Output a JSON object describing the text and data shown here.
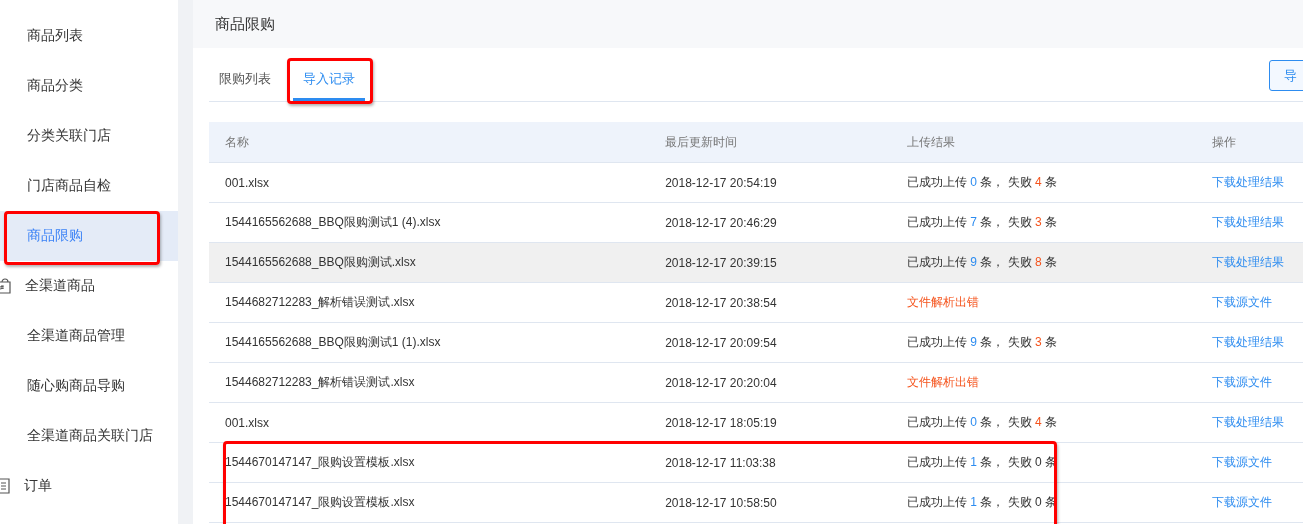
{
  "sidebar": {
    "items": [
      {
        "label": "商品列表",
        "kind": "link",
        "selected": false,
        "circled": false
      },
      {
        "label": "商品分类",
        "kind": "link",
        "selected": false,
        "circled": false
      },
      {
        "label": "分类关联门店",
        "kind": "link",
        "selected": false,
        "circled": false
      },
      {
        "label": "门店商品自检",
        "kind": "link",
        "selected": false,
        "circled": false
      },
      {
        "label": "商品限购",
        "kind": "link",
        "selected": true,
        "circled": true
      },
      {
        "label": "全渠道商品",
        "kind": "group",
        "selected": false,
        "circled": false
      },
      {
        "label": "全渠道商品管理",
        "kind": "link",
        "selected": false,
        "circled": false
      },
      {
        "label": "随心购商品导购",
        "kind": "link",
        "selected": false,
        "circled": false
      },
      {
        "label": "全渠道商品关联门店",
        "kind": "link",
        "selected": false,
        "circled": false
      },
      {
        "label": "订单",
        "kind": "group",
        "selected": false,
        "circled": false
      }
    ]
  },
  "page": {
    "title": "商品限购",
    "tabs": [
      {
        "label": "限购列表",
        "selected": false,
        "circled": false
      },
      {
        "label": "导入记录",
        "selected": true,
        "circled": true
      }
    ],
    "button": "导",
    "table": {
      "columns": [
        "名称",
        "最后更新时间",
        "上传结果",
        "操作"
      ],
      "rows": [
        {
          "name": "001.xlsx",
          "time": "2018-12-17 20:54:19",
          "result": {
            "kind": "counts",
            "a": "已成功上传",
            "ok": "0",
            "b": "条，",
            "c": "失败",
            "fail": "4",
            "fail_highlight": true,
            "d": "条"
          },
          "action": "下载处理结果",
          "hovered": false,
          "circled": false
        },
        {
          "name": "1544165562688_BBQ限购测试1 (4).xlsx",
          "time": "2018-12-17 20:46:29",
          "result": {
            "kind": "counts",
            "a": "已成功上传",
            "ok": "7",
            "b": "条，",
            "c": "失败",
            "fail": "3",
            "fail_highlight": true,
            "d": "条"
          },
          "action": "下载处理结果",
          "hovered": false,
          "circled": false
        },
        {
          "name": "1544165562688_BBQ限购测试.xlsx",
          "time": "2018-12-17 20:39:15",
          "result": {
            "kind": "counts",
            "a": "已成功上传",
            "ok": "9",
            "b": "条，",
            "c": "失败",
            "fail": "8",
            "fail_highlight": true,
            "d": "条"
          },
          "action": "下载处理结果",
          "hovered": true,
          "circled": false
        },
        {
          "name": "1544682712283_解析错误测试.xlsx",
          "time": "2018-12-17 20:38:54",
          "result": {
            "kind": "error",
            "text": "文件解析出错"
          },
          "action": "下载源文件",
          "hovered": false,
          "circled": false
        },
        {
          "name": "1544165562688_BBQ限购测试1 (1).xlsx",
          "time": "2018-12-17 20:09:54",
          "result": {
            "kind": "counts",
            "a": "已成功上传",
            "ok": "9",
            "b": "条，",
            "c": "失败",
            "fail": "3",
            "fail_highlight": true,
            "d": "条"
          },
          "action": "下载处理结果",
          "hovered": false,
          "circled": false
        },
        {
          "name": "1544682712283_解析错误测试.xlsx",
          "time": "2018-12-17 20:20:04",
          "result": {
            "kind": "error",
            "text": "文件解析出错"
          },
          "action": "下载源文件",
          "hovered": false,
          "circled": false
        },
        {
          "name": "001.xlsx",
          "time": "2018-12-17 18:05:19",
          "result": {
            "kind": "counts",
            "a": "已成功上传",
            "ok": "0",
            "b": "条，",
            "c": "失败",
            "fail": "4",
            "fail_highlight": true,
            "d": "条"
          },
          "action": "下载处理结果",
          "hovered": false,
          "circled": false
        },
        {
          "name": "1544670147147_限购设置模板.xlsx",
          "time": "2018-12-17 11:03:38",
          "result": {
            "kind": "counts",
            "a": "已成功上传",
            "ok": "1",
            "b": "条，",
            "c": "失败",
            "fail": "0",
            "fail_highlight": false,
            "d": "条"
          },
          "action": "下载源文件",
          "hovered": false,
          "circled": true
        },
        {
          "name": "1544670147147_限购设置模板.xlsx",
          "time": "2018-12-17 10:58:50",
          "result": {
            "kind": "counts",
            "a": "已成功上传",
            "ok": "1",
            "b": "条，",
            "c": "失败",
            "fail": "0",
            "fail_highlight": false,
            "d": "条"
          },
          "action": "下载源文件",
          "hovered": false,
          "circled": true
        }
      ]
    }
  }
}
